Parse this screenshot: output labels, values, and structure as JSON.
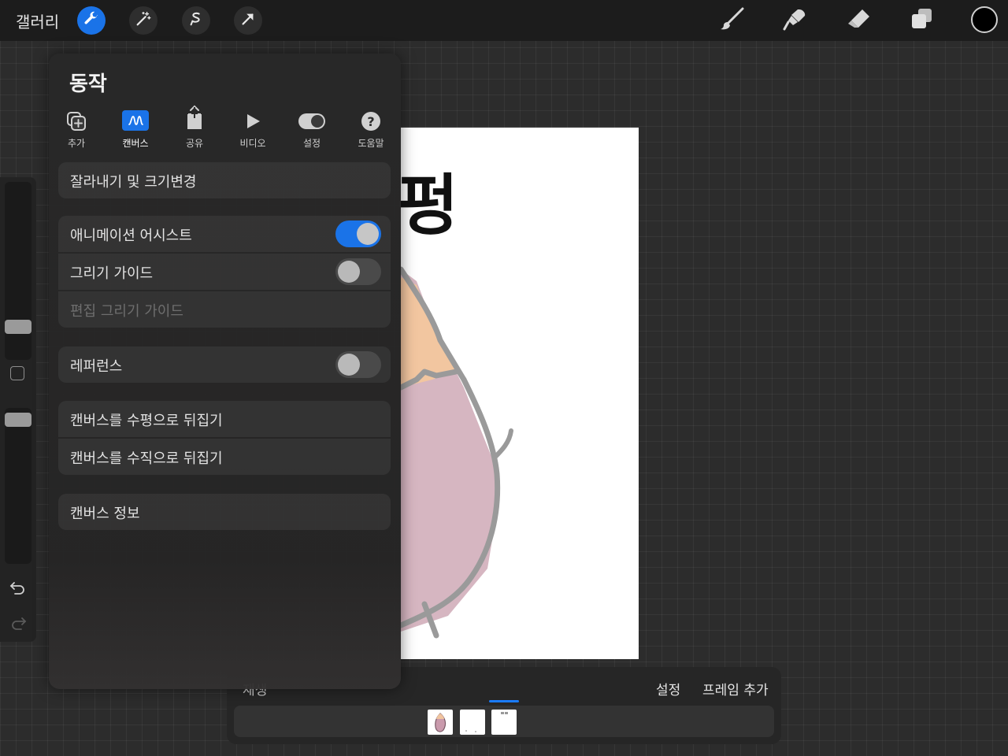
{
  "topbar": {
    "gallery_label": "갤러리",
    "left_tools": [
      "wrench-icon",
      "magic-wand-icon",
      "selection-icon",
      "transform-arrow-icon"
    ],
    "right_tools": [
      "brush-icon",
      "smudge-icon",
      "eraser-icon",
      "layers-icon"
    ],
    "current_color": "#000000"
  },
  "actions_panel": {
    "title": "동작",
    "tabs": [
      {
        "label": "추가",
        "icon": "add-icon"
      },
      {
        "label": "캔버스",
        "icon": "canvas-icon",
        "selected": true
      },
      {
        "label": "공유",
        "icon": "share-icon"
      },
      {
        "label": "비디오",
        "icon": "play-icon"
      },
      {
        "label": "설정",
        "icon": "toggle-icon"
      },
      {
        "label": "도움말",
        "icon": "help-icon"
      }
    ],
    "items": {
      "crop_resize": "잘라내기 및 크기변경",
      "animation_assist": {
        "label": "애니메이션 어시스트",
        "on": true
      },
      "drawing_guide": {
        "label": "그리기 가이드",
        "on": false
      },
      "edit_drawing_guide": "편집 그리기 가이드",
      "reference": {
        "label": "레퍼런스",
        "on": false
      },
      "flip_horizontal": "캔버스를 수평으로 뒤집기",
      "flip_vertical": "캔버스를 수직으로 뒤집기",
      "canvas_info": "캔버스 정보"
    }
  },
  "canvas": {
    "visible_text": "펑"
  },
  "timeline": {
    "title": "재생",
    "settings_label": "설정",
    "add_frame_label": "프레임 추가",
    "frame_count": 3,
    "selected_frame": 3
  },
  "colors": {
    "accent": "#1a73e8",
    "background": "#2c2c2c",
    "panel": "#282828"
  }
}
